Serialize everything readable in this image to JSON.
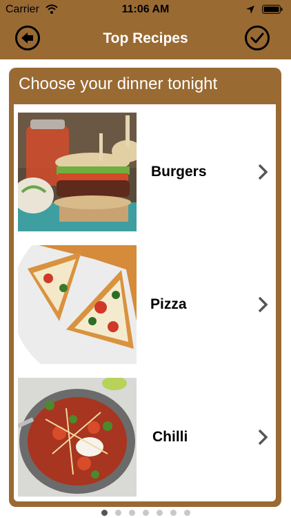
{
  "status_bar": {
    "carrier": "Carrier",
    "time": "11:06 AM"
  },
  "nav": {
    "title": "Top Recipes",
    "back_icon": "back-arrow-icon",
    "confirm_icon": "checkmark-icon"
  },
  "card": {
    "header": "Choose your dinner tonight"
  },
  "recipes": [
    {
      "label": "Burgers"
    },
    {
      "label": "Pizza"
    },
    {
      "label": "Chilli"
    }
  ],
  "pager": {
    "count": 7,
    "active_index": 0
  },
  "colors": {
    "brand": "#9a6a33",
    "title_text": "#ffffff"
  }
}
